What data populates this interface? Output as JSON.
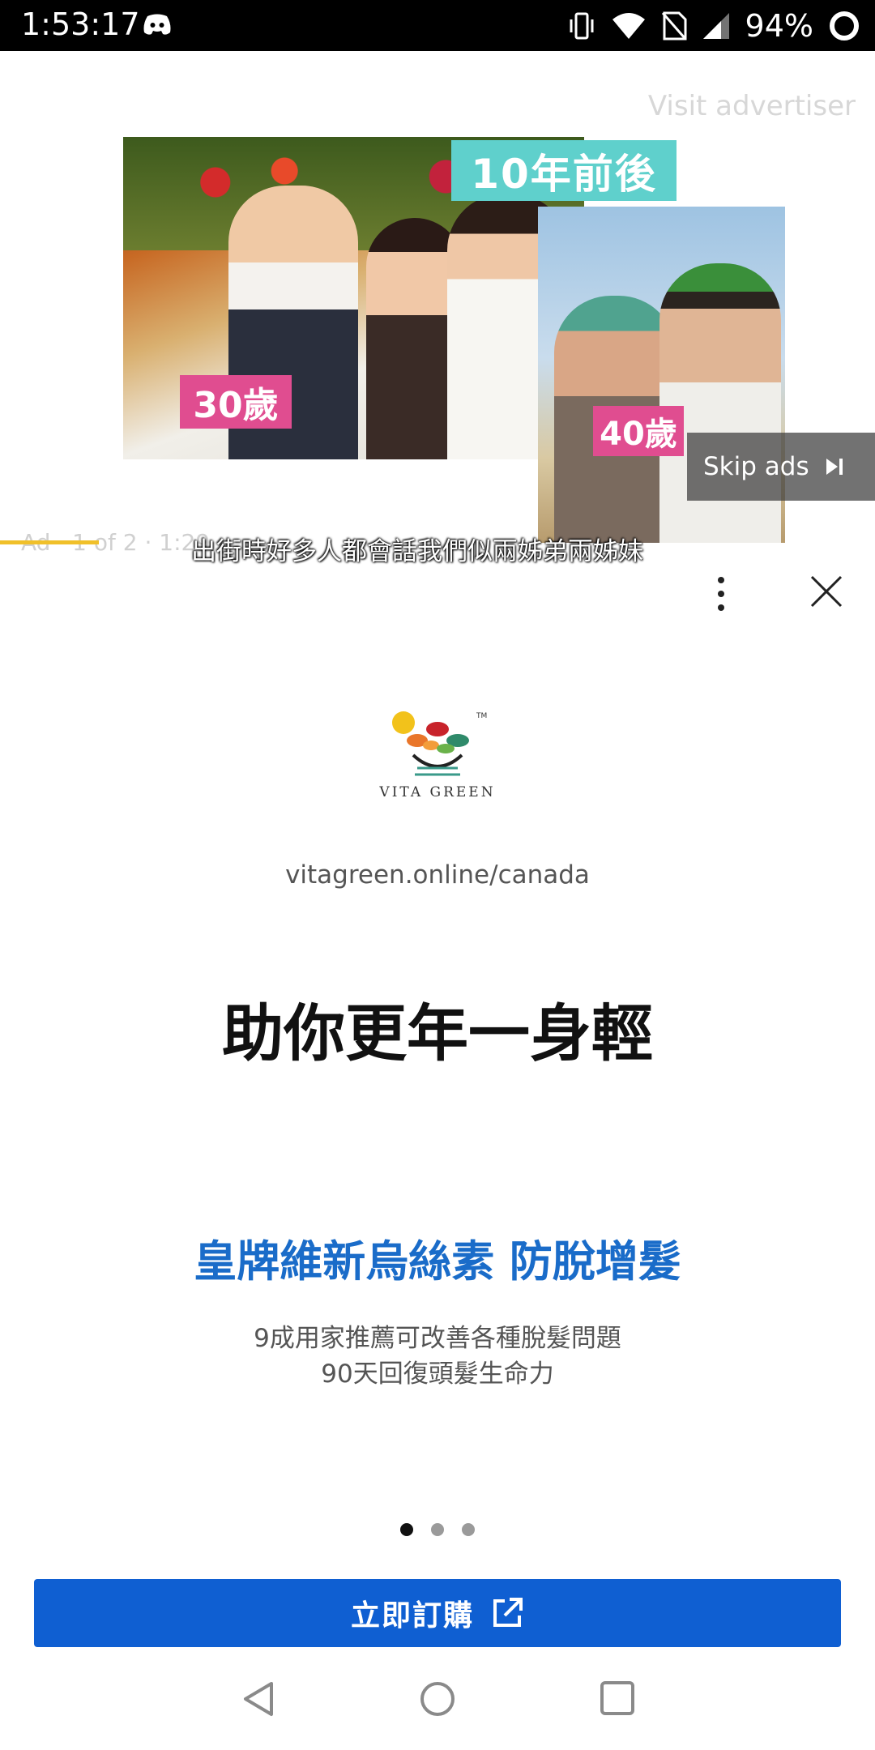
{
  "status_bar": {
    "time": "1:53:17",
    "battery": "94%",
    "icons": [
      "discord-icon",
      "vibrate-icon",
      "wifi-icon",
      "no-sim-icon",
      "signal-icon",
      "battery-ring-icon"
    ]
  },
  "video_ad": {
    "visit_advertiser": "Visit advertiser",
    "tag_top": "10年前後",
    "tag_30": "30歲",
    "tag_40": "40歲",
    "skip_label": "Skip ads",
    "ad_info": "Ad · 1 of 2 · 1:29",
    "subtitle": "出街時好多人都會話我們似兩姊弟兩姊妹",
    "progress": 0.113,
    "progress_color": "#f0c02a"
  },
  "brand": {
    "logo_text": "VITA GREEN",
    "url": "vitagreen.online/canada"
  },
  "content": {
    "headline": "助你更年一身輕",
    "sub_headline": "皇牌維新烏絲素 防脫增髮",
    "sub_headline_color": "#1a6cc9",
    "desc_line1": "9成用家推薦可改善各種脫髮問題",
    "desc_line2": "90天回復頭髮生命力"
  },
  "carousel": {
    "count": 3,
    "active_index": 0
  },
  "cta": {
    "label": "立即訂購",
    "color": "#0f5fd2",
    "icon": "external-link-icon"
  },
  "nav": {
    "icons": [
      "back-icon",
      "home-icon",
      "recents-icon"
    ]
  }
}
